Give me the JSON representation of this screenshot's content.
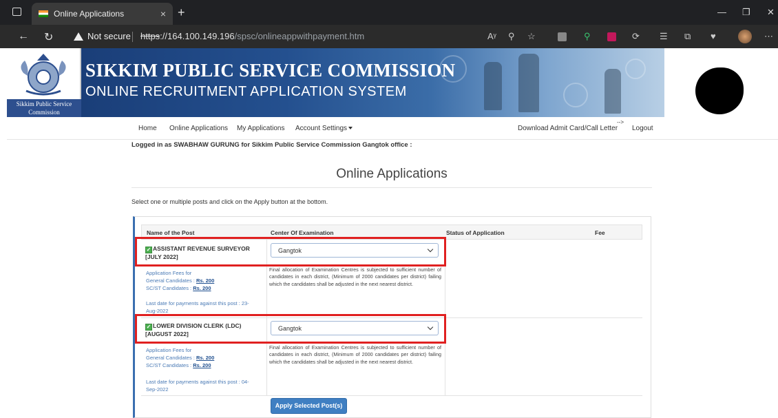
{
  "browser": {
    "tab_title": "Online Applications",
    "tab_close": "×",
    "new_tab": "+",
    "security_label": "Not secure",
    "url_protocol": "https",
    "url_host": "://164.100.149.196",
    "url_path": "/spsc/onlineappwithpayment.htm"
  },
  "banner": {
    "title": "SIKKIM PUBLIC SERVICE COMMISSION",
    "subtitle": "ONLINE RECRUITMENT APPLICATION SYSTEM",
    "emblem_caption_1": "Sikkim Public Service",
    "emblem_caption_2": "Commission"
  },
  "nav": {
    "home": "Home",
    "online_applications": "Online Applications",
    "my_applications": "My Applications",
    "account_settings": "Account Settings",
    "download": "Download Admit Card/Call Letter",
    "arrow": "-->",
    "logout": "Logout"
  },
  "logged_in": "Logged in as SWABHAW GURUNG for Sikkim Public Service Commission Gangtok office :",
  "page_title": "Online Applications",
  "instruction": "Select one or multiple posts and click on the Apply button at the bottom.",
  "table": {
    "headers": {
      "post": "Name of the Post",
      "center": "Center Of Examination",
      "status": "Status of Application",
      "fee": "Fee"
    },
    "rows": [
      {
        "post": "ASSISTANT REVENUE SURVEYOR [JULY 2022]",
        "center": "Gangtok",
        "fees_label": "Application Fees for",
        "general_label": "General Candidates : ",
        "general_amount": "Rs. 200",
        "scst_label": "SC/ST Candidates : ",
        "scst_amount": "Rs. 200",
        "last_date": "Last date for payments against this post : 23-Aug-2022",
        "note": "Final allocation of Examination Centres is subjected to sufficient number of candidates in each district, (Minimum of 2000 candidates per district) failing which the candidates shall be adjusted in the next nearest district."
      },
      {
        "post": "LOWER DIVISION CLERK (LDC) [AUGUST 2022]",
        "center": "Gangtok",
        "fees_label": "Application Fees for",
        "general_label": "General Candidates : ",
        "general_amount": "Rs. 200",
        "scst_label": "SC/ST Candidates : ",
        "scst_amount": "Rs. 200",
        "last_date": "Last date for payments against this post : 04-Sep-2022",
        "note": "Final allocation of Examination Centres is subjected to sufficient number of candidates in each district, (Minimum of 2000 candidates per district) failing which the candidates shall be adjusted in the next nearest district."
      }
    ]
  },
  "apply_button": "Apply Selected Post(s)",
  "colors": {
    "accent": "#3f7fc2",
    "highlight": "#e02020",
    "banner": "#24508f"
  }
}
